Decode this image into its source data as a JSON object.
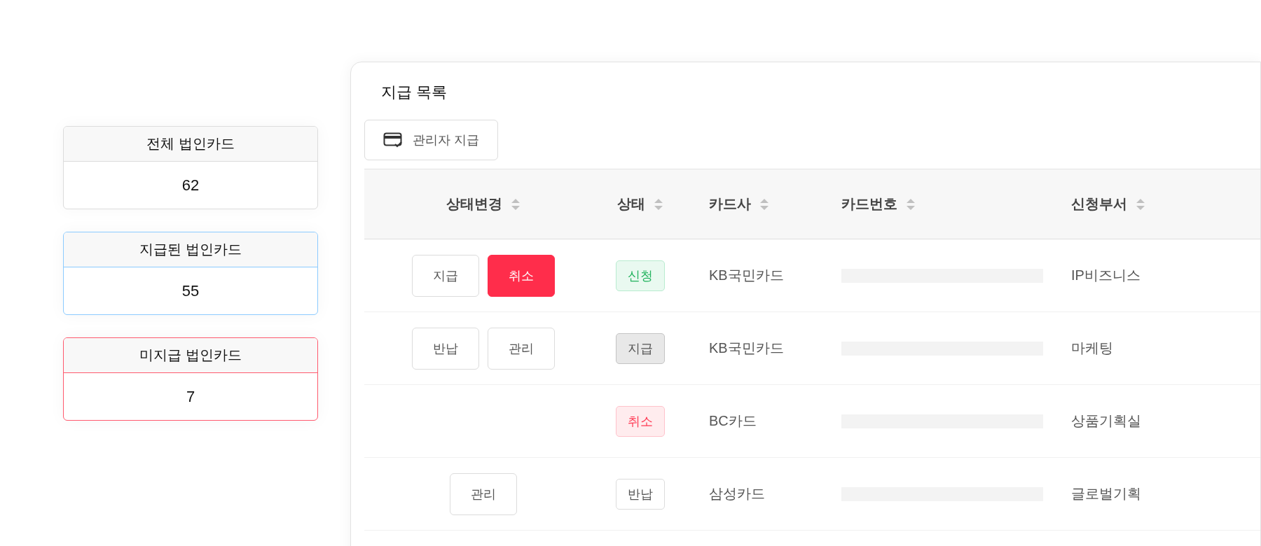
{
  "stats": [
    {
      "label": "전체 법인카드",
      "value": "62",
      "color": "#dcdcdc"
    },
    {
      "label": "지급된 법인카드",
      "value": "55",
      "color": "#8ccbff"
    },
    {
      "label": "미지급 법인카드",
      "value": "7",
      "color": "#ff5a6e"
    }
  ],
  "panel": {
    "title": "지급 목록",
    "admin_button": "관리자 지급"
  },
  "table": {
    "columns": [
      "상태변경",
      "상태",
      "카드사",
      "카드번호",
      "신청부서"
    ],
    "rows": [
      {
        "actions": [
          {
            "label": "지급",
            "kind": "default"
          },
          {
            "label": "취소",
            "kind": "danger"
          }
        ],
        "status": {
          "label": "신청",
          "kind": "requested"
        },
        "card_company": "KB국민카드",
        "department": "IP비즈니스"
      },
      {
        "actions": [
          {
            "label": "반납",
            "kind": "default"
          },
          {
            "label": "관리",
            "kind": "default"
          }
        ],
        "status": {
          "label": "지급",
          "kind": "issued"
        },
        "card_company": "KB국민카드",
        "department": "마케팅"
      },
      {
        "actions": [],
        "status": {
          "label": "취소",
          "kind": "cancelled"
        },
        "card_company": "BC카드",
        "department": "상품기획실"
      },
      {
        "actions": [
          {
            "label": "관리",
            "kind": "default"
          }
        ],
        "status": {
          "label": "반납",
          "kind": "returned"
        },
        "card_company": "삼성카드",
        "department": "글로벌기획"
      }
    ]
  }
}
